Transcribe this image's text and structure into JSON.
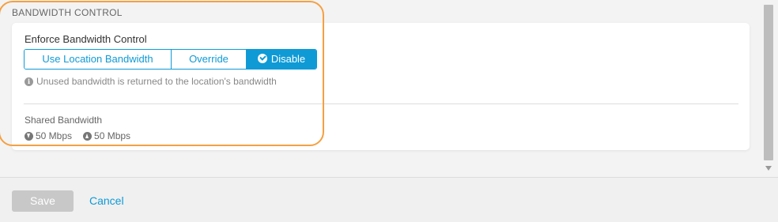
{
  "section": {
    "title": "BANDWIDTH CONTROL"
  },
  "enforce": {
    "label": "Enforce Bandwidth Control",
    "options": [
      "Use Location Bandwidth",
      "Override",
      "Disable"
    ],
    "selected": "Disable",
    "note": "Unused bandwidth is returned to the location's bandwidth"
  },
  "shared": {
    "label": "Shared Bandwidth",
    "download": "50 Mbps",
    "upload": "50 Mbps"
  },
  "footer": {
    "save_label": "Save",
    "cancel_label": "Cancel"
  },
  "colors": {
    "accent": "#0f9ad6",
    "highlight": "#f5a042",
    "disabled_button": "#c8c8c8"
  },
  "icons": {
    "info": "info-circle-icon",
    "download": "arrow-down-circle-icon",
    "upload": "arrow-up-circle-icon",
    "selected": "check-circle-icon"
  }
}
